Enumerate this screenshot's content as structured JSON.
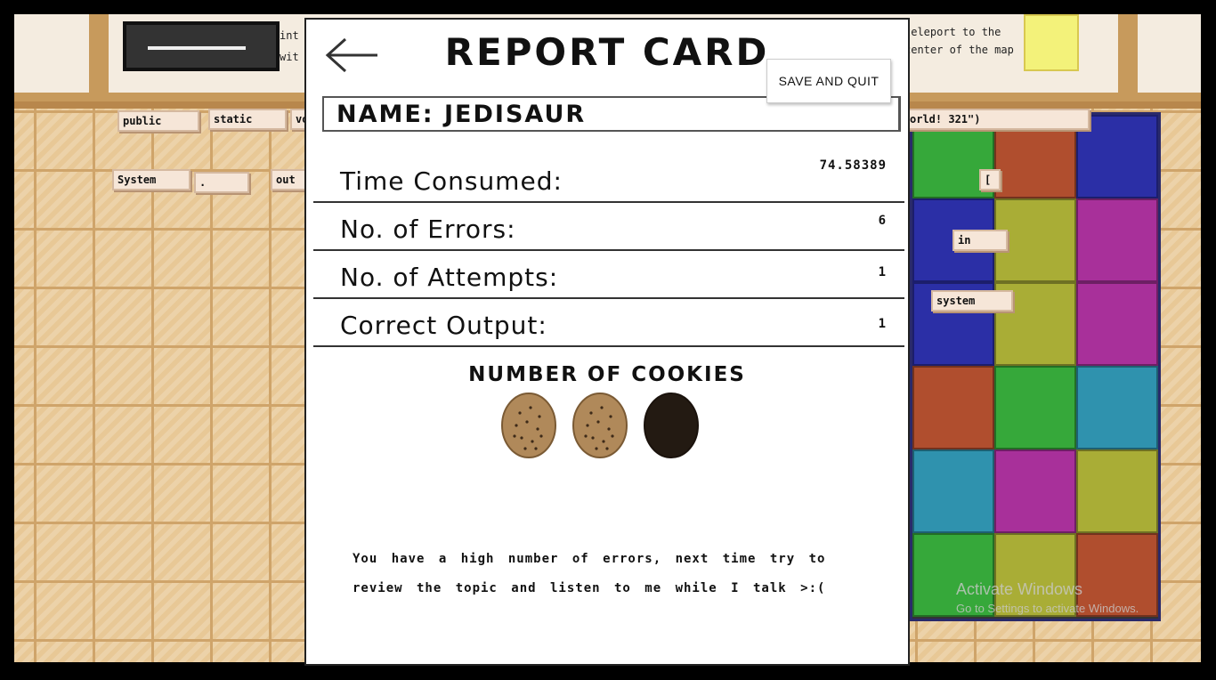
{
  "background": {
    "top_hint_left": "int\nwit",
    "top_hint_right": "teleport to the\ncenter of the map",
    "code_tags": [
      "public",
      "static",
      "vo",
      "System",
      ".",
      "out",
      "orld! 321\")",
      "[",
      "in",
      "system"
    ],
    "watermark_title": "Activate Windows",
    "watermark_sub": "Go to Settings to activate Windows."
  },
  "report": {
    "title": "REPORT CARD",
    "save_quit_label": "SAVE AND QUIT",
    "name_text": "NAME: JEDISAUR",
    "stats": [
      {
        "label": "Time Consumed:",
        "value": "74.58389"
      },
      {
        "label": "No. of Errors:",
        "value": "6"
      },
      {
        "label": "No. of Attempts:",
        "value": "1"
      },
      {
        "label": "Correct Output:",
        "value": "1"
      }
    ],
    "cookies_title": "NUMBER OF COOKIES",
    "cookies_earned": 2,
    "cookies_total": 3,
    "feedback": "You have a high number of errors, next time try to review the topic and listen to me while I talk >:("
  },
  "icons": {
    "back": "back-arrow-icon",
    "cookie": "cookie-icon"
  },
  "colors": {
    "cookie_earned": "#b0895a",
    "cookie_missing": "#231a12",
    "piece_colors": [
      "#36a83a",
      "#b04e2e",
      "#2b2fa6",
      "#a9ad36",
      "#a8309a",
      "#2f92ae"
    ]
  }
}
